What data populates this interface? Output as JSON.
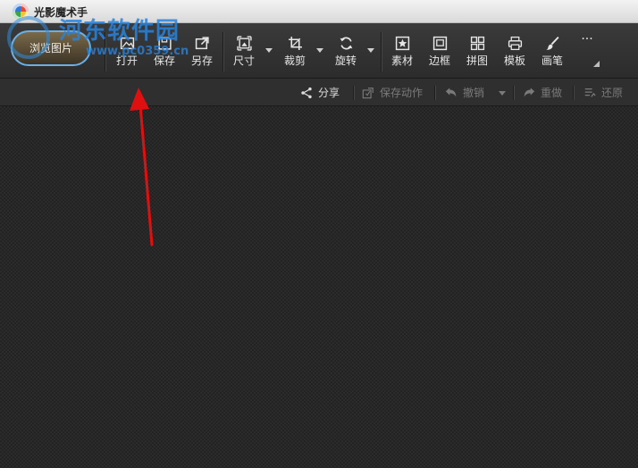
{
  "window": {
    "title": "光影魔术手"
  },
  "watermark": {
    "text": "河东软件园",
    "url": "www.pc0359.cn"
  },
  "toolbar": {
    "browse_label": "浏览图片",
    "tools": [
      {
        "name": "open",
        "label": "打开",
        "icon": "open-image-icon"
      },
      {
        "name": "save",
        "label": "保存",
        "icon": "save-icon"
      },
      {
        "name": "save-as",
        "label": "另存",
        "icon": "save-as-icon"
      },
      {
        "name": "size",
        "label": "尺寸",
        "icon": "resize-icon",
        "dropdown": true
      },
      {
        "name": "crop",
        "label": "裁剪",
        "icon": "crop-icon",
        "dropdown": true
      },
      {
        "name": "rotate",
        "label": "旋转",
        "icon": "rotate-icon",
        "dropdown": true
      },
      {
        "name": "material",
        "label": "素材",
        "icon": "star-frame-icon"
      },
      {
        "name": "border",
        "label": "边框",
        "icon": "border-icon"
      },
      {
        "name": "collage",
        "label": "拼图",
        "icon": "grid-icon"
      },
      {
        "name": "template",
        "label": "模板",
        "icon": "printer-icon"
      },
      {
        "name": "brush",
        "label": "画笔",
        "icon": "brush-icon"
      }
    ],
    "more_label": "···"
  },
  "subbar": {
    "share": "分享",
    "save_action": "保存动作",
    "undo": "撤销",
    "redo": "重做",
    "restore": "还原"
  },
  "colors": {
    "annotation_arrow": "#e01010",
    "accent_ring": "#6ab0e8"
  }
}
